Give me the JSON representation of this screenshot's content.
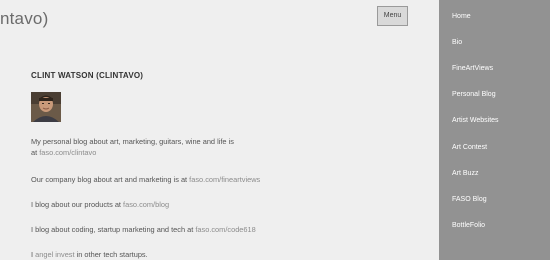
{
  "header": {
    "site_title": "intavo)",
    "menu_label": "Menu"
  },
  "sidebar": {
    "items": [
      {
        "label": "Home"
      },
      {
        "label": "Bio"
      },
      {
        "label": "FineArtViews"
      },
      {
        "label": "Personal Blog"
      },
      {
        "label": "Artist Websites"
      },
      {
        "label": "Art Contest"
      },
      {
        "label": "Art Buzz"
      },
      {
        "label": "FASO Blog"
      },
      {
        "label": "BottleFolio"
      }
    ]
  },
  "main": {
    "author_name": "CLINT WATSON (CLINTAVO)",
    "p1": {
      "line1": "My personal blog about art,  marketing, guitars, wine and life is",
      "prefix": "at ",
      "link": "faso.com/clintavo"
    },
    "p2": {
      "text": "Our company blog about art and marketing is at ",
      "link": "faso.com/fineartviews"
    },
    "p3": {
      "text": "I blog about our products at ",
      "link": "faso.com/blog"
    },
    "p4": {
      "text": "I blog about coding, startup marketing and tech at ",
      "link": "faso.com/code618"
    },
    "p5": {
      "prefix": "I ",
      "link": "angel invest",
      "suffix": " in other tech startups."
    }
  }
}
